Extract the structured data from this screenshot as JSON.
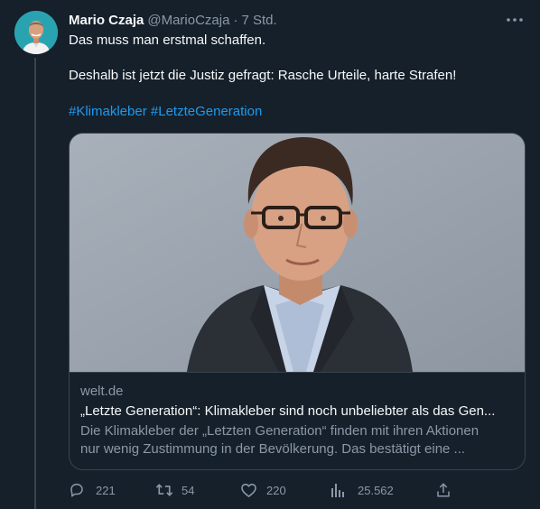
{
  "author": {
    "name": "Mario Czaja",
    "handle": "@MarioCzaja",
    "separator": "·",
    "time": "7 Std."
  },
  "tweet": {
    "line1": "Das muss man erstmal schaffen.",
    "line2": "Deshalb ist jetzt die Justiz gefragt: Rasche Urteile, harte Strafen!",
    "hashtags": [
      "#Klimakleber",
      "#LetzteGeneration"
    ]
  },
  "card": {
    "domain": "welt.de",
    "title": "„Letzte Generation“: Klimakleber sind noch unbeliebter als das Gen...",
    "description_line1": "Die Klimakleber der „Letzten Generation“ finden mit ihren Aktionen",
    "description_line2": "nur wenig Zustimmung in der Bevölkerung. Das bestätigt eine ..."
  },
  "actions": {
    "replies": "221",
    "retweets": "54",
    "likes": "220",
    "views": "25.562"
  },
  "icons": {
    "more": "more-icon",
    "reply": "reply-icon",
    "retweet": "retweet-icon",
    "like": "heart-icon",
    "views": "views-icon",
    "share": "share-icon"
  },
  "colors": {
    "background": "#15202b",
    "text": "#f7f9f9",
    "secondary": "#8b98a5",
    "link": "#1d9bf0",
    "border": "#38444d"
  }
}
